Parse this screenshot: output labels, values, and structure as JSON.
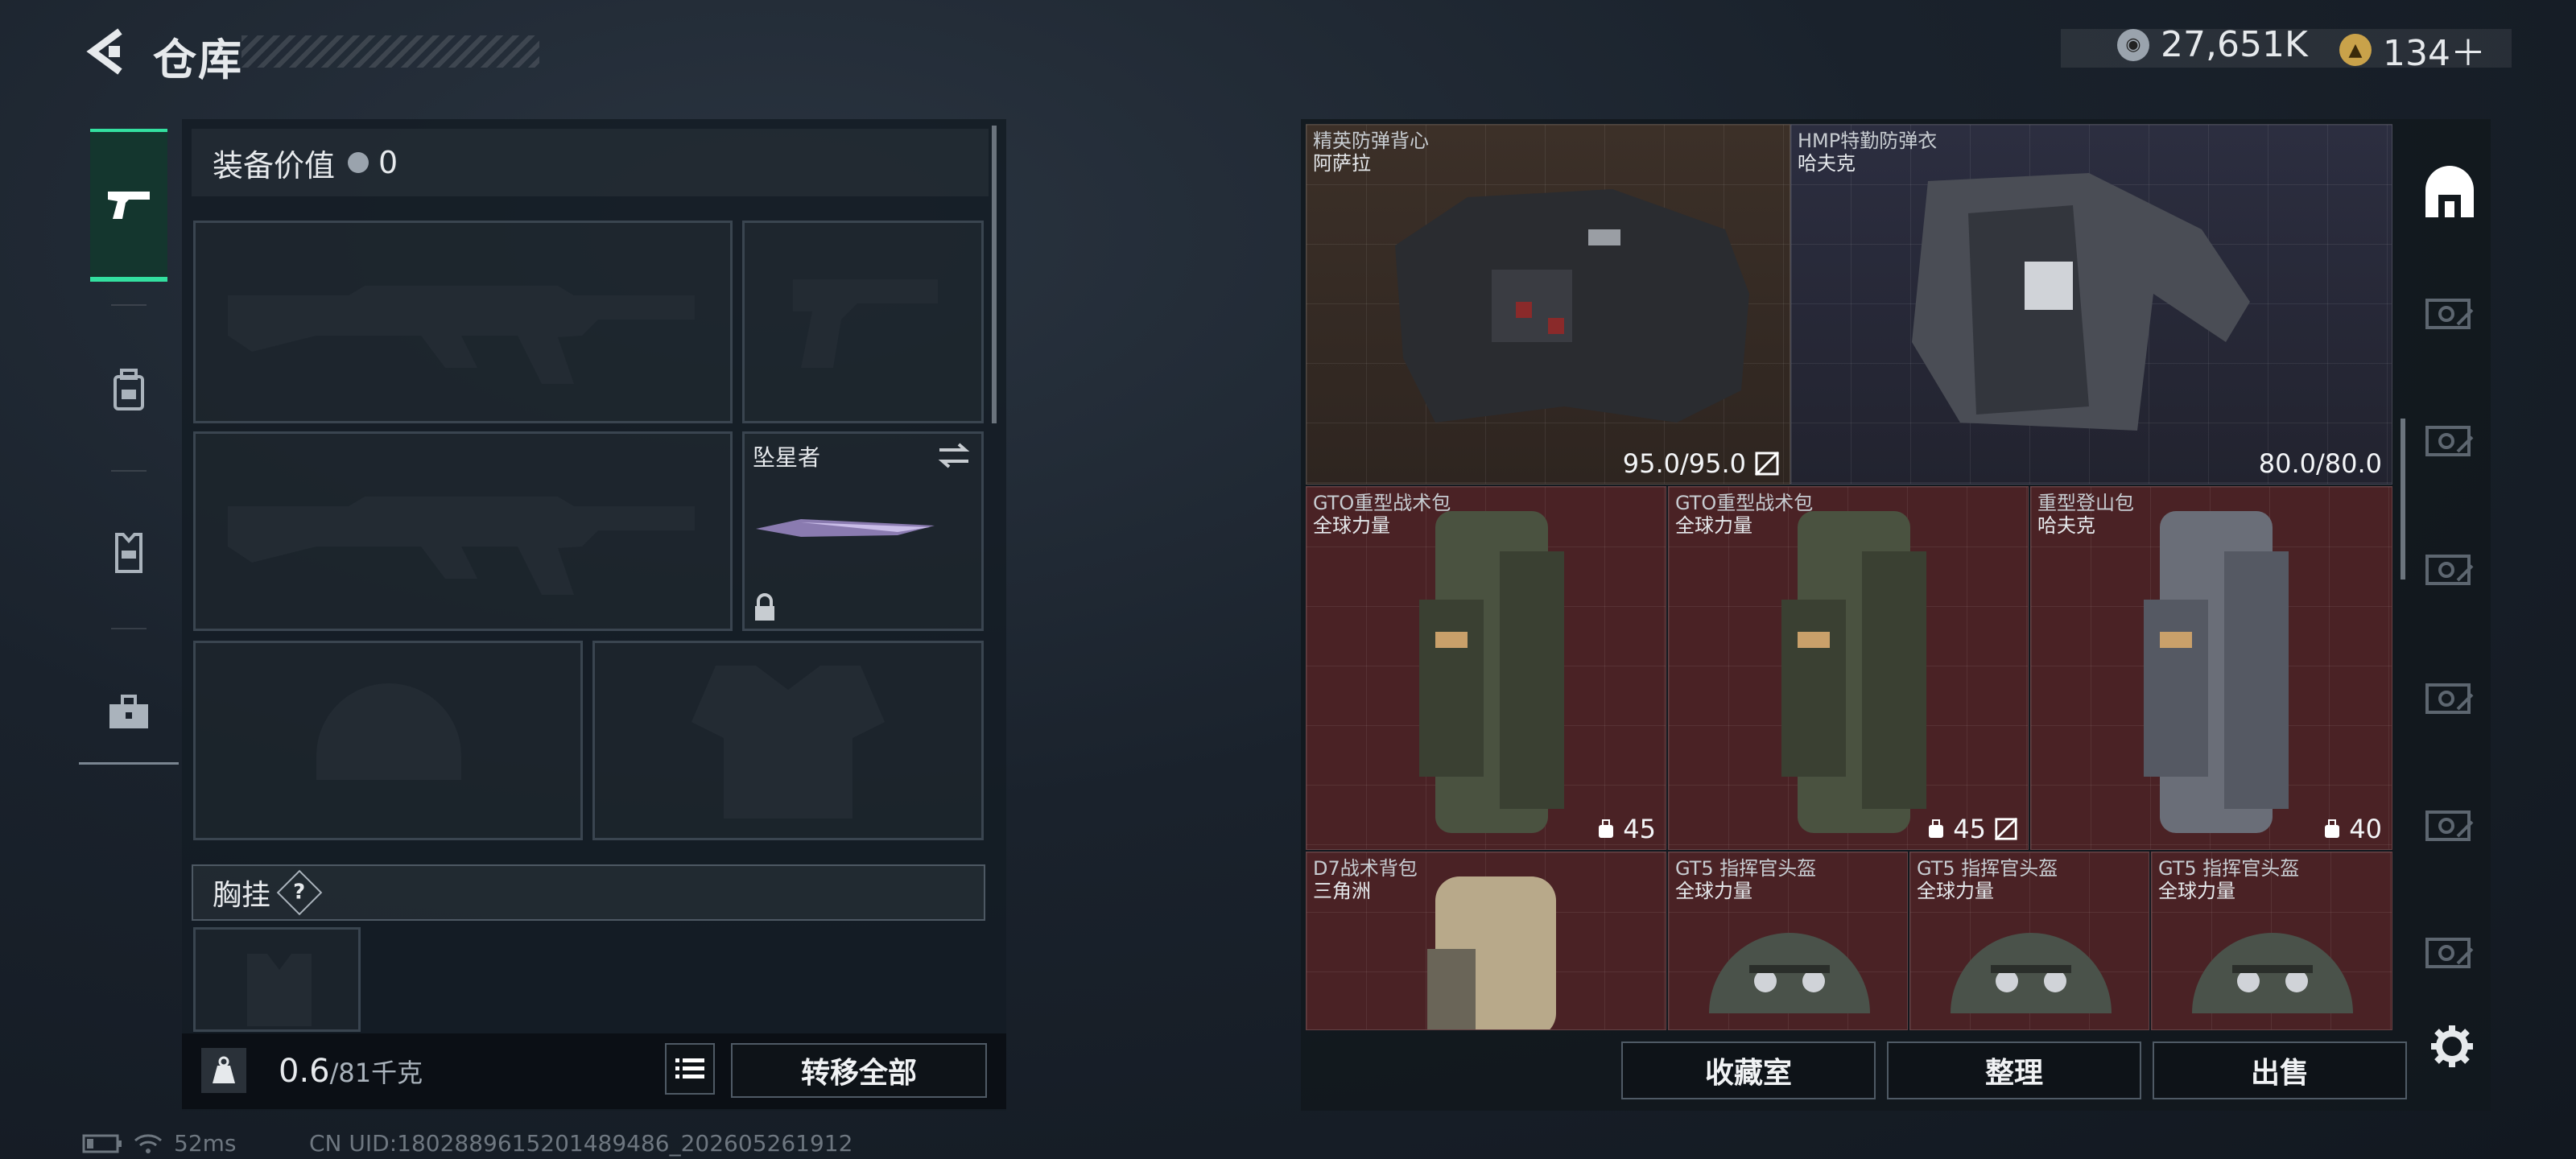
{
  "header": {
    "title": "仓库",
    "currency_primary": "27,651K",
    "currency_secondary": "134＋"
  },
  "rail": {
    "tabs": [
      {
        "name": "pistol",
        "active": true
      },
      {
        "name": "backpack",
        "active": false
      },
      {
        "name": "vest",
        "active": false
      },
      {
        "name": "toolbox",
        "active": false
      }
    ]
  },
  "loadout": {
    "equipment_value_label": "装备价值",
    "equipment_value": "0",
    "melee_name": "坠星者",
    "chest_label": "胸挂",
    "chest_help": "?",
    "weight_current": "0.6",
    "weight_max": "/81千克",
    "transfer_all": "转移全部"
  },
  "stash": {
    "items": [
      {
        "title": "精英防弹背心",
        "maker": "阿萨拉",
        "stat": "95.0/95.0"
      },
      {
        "title": "HMP特勤防弹衣",
        "maker": "哈夫克",
        "stat": "80.0/80.0"
      },
      {
        "title": "GTO重型战术包",
        "maker": "全球力量",
        "stat": "45"
      },
      {
        "title": "GTO重型战术包",
        "maker": "全球力量",
        "stat": "45"
      },
      {
        "title": "重型登山包",
        "maker": "哈夫克",
        "stat": "40"
      },
      {
        "title": "D7战术背包",
        "maker": "三角洲",
        "stat": ""
      },
      {
        "title": "GT5 指挥官头盔",
        "maker": "全球力量",
        "stat": ""
      },
      {
        "title": "GT5 指挥官头盔",
        "maker": "全球力量",
        "stat": ""
      },
      {
        "title": "GT5 指挥官头盔",
        "maker": "全球力量",
        "stat": ""
      }
    ],
    "buttons": {
      "collection": "收藏室",
      "sort": "整理",
      "sell": "出售"
    }
  },
  "status": {
    "ping": "52ms",
    "uid": "CN UID:1802889615201489486_202605261912"
  },
  "colors": {
    "accent": "#33e0a0",
    "item_red": "#4a2225"
  }
}
